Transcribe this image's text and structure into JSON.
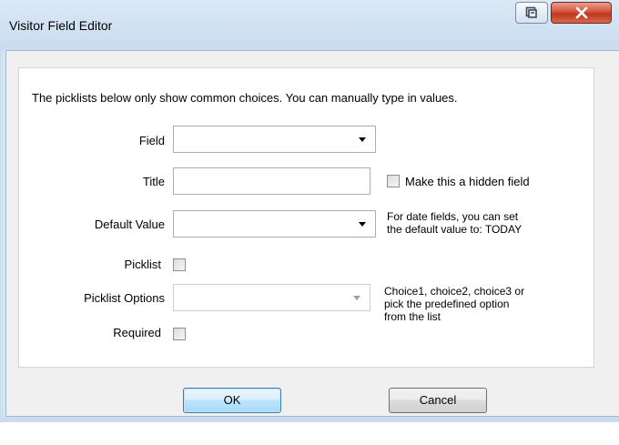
{
  "window": {
    "title": "Visitor Field Editor",
    "controls": {
      "restore_icon": "restore-icon",
      "close_icon": "close-icon",
      "close_color": "#c7432a"
    }
  },
  "form": {
    "instructions": "The picklists below only show common choices. You can manually type in values.",
    "field": {
      "label": "Field",
      "value": ""
    },
    "title": {
      "label": "Title",
      "value": ""
    },
    "hidden": {
      "label": "Make this a hidden field",
      "checked": false
    },
    "default_value": {
      "label": "Default Value",
      "value": "",
      "hint_line1": "For date fields, you can set",
      "hint_line2": "the default value to: TODAY"
    },
    "picklist": {
      "label": "Picklist",
      "checked": false
    },
    "picklist_options": {
      "label": "Picklist Options",
      "value": "",
      "hint_line1": "Choice1, choice2, choice3 or",
      "hint_line2": "pick the predefined  option",
      "hint_line3": "from the list"
    },
    "required": {
      "label": "Required",
      "checked": false
    }
  },
  "buttons": {
    "ok": "OK",
    "cancel": "Cancel"
  },
  "colors": {
    "default_button_border": "#3c7fb1",
    "title_bar": "#c9dcf0"
  }
}
